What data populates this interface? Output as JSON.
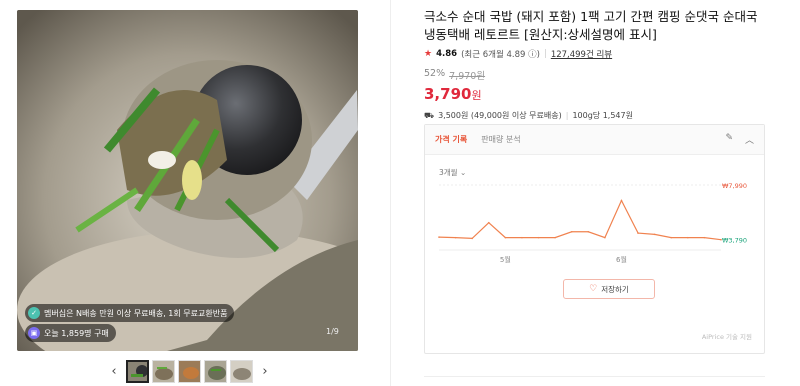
{
  "gallery": {
    "member_badge": "멤버십은 N배송 만원 이상 무료배송, 1회 무료교환반품",
    "buy_badge": "오늘 1,859명 구매",
    "counter": "1/9",
    "thumbnail_count": 5,
    "active_thumbnail": 1
  },
  "product": {
    "title": "극소수 순대 국밥 (돼지 포함) 1팩 고기 간편 캠핑 순댓국 순대국 냉동택배 레토르트 [원산지:상세설명에 표시]",
    "rating": "4.86",
    "recent_rating": "(최근 6개월 4.89",
    "reviews": "127,499건 리뷰",
    "discount_rate": "52%",
    "original_price": "7,970원",
    "price": "3,790",
    "price_unit": "원",
    "shipping": "3,500원 (49,000원 이상 무료배송)",
    "unit_price": "100g당 1,547원"
  },
  "panel": {
    "tab_active": "가격 기록",
    "tab_other": "판매량 분석",
    "period": "3개월",
    "save_label": "저장하기",
    "credit": "AiPrice 기술 지원"
  },
  "chart_data": {
    "type": "line",
    "series_color": "#f0824f",
    "points": [
      3990,
      3950,
      3890,
      5100,
      3950,
      3950,
      3950,
      3950,
      4400,
      4400,
      3950,
      6800,
      4300,
      4200,
      3950,
      3950,
      3950,
      3790
    ],
    "tick_labels": [
      "5월",
      "6월"
    ],
    "tick_positions": [
      4,
      11
    ],
    "max_label": "₩7,990",
    "min_label": "₩3,790",
    "ylim": [
      3000,
      7990
    ],
    "grid": true
  }
}
